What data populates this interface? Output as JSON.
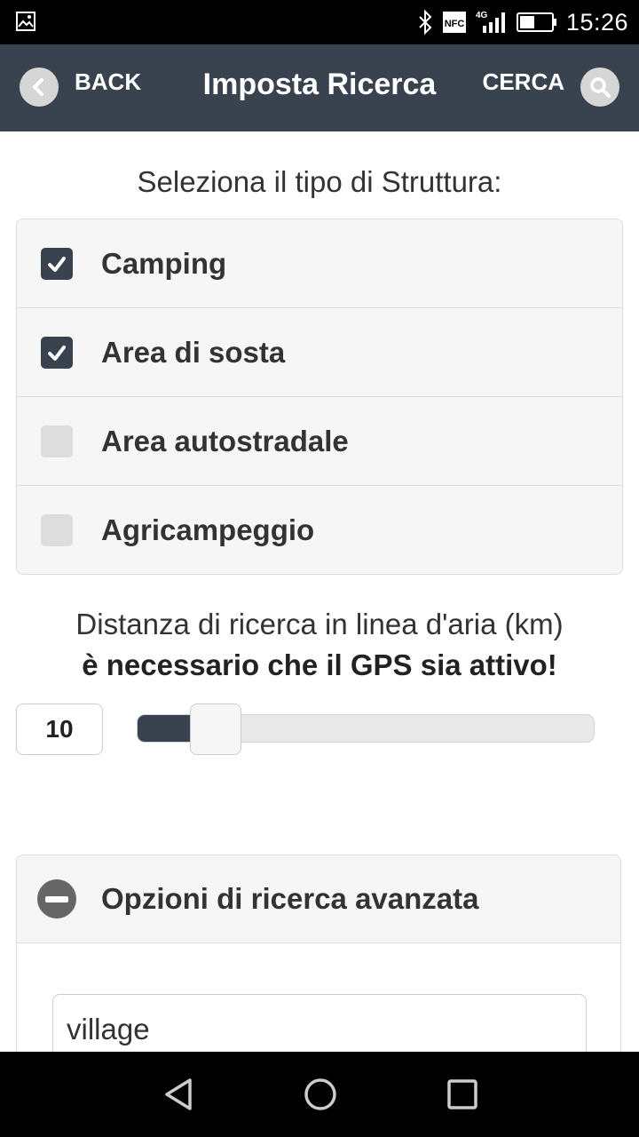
{
  "status_bar": {
    "time": "15:26",
    "icons": [
      "gallery-icon",
      "bluetooth-icon",
      "nfc-icon",
      "signal-4g-icon",
      "battery-icon"
    ],
    "nfc_label": "NFC",
    "network_label": "4G"
  },
  "header": {
    "back_label": "BACK",
    "title": "Imposta Ricerca",
    "search_label": "CERCA"
  },
  "structure": {
    "prompt": "Seleziona il tipo di Struttura:",
    "items": [
      {
        "label": "Camping",
        "checked": true
      },
      {
        "label": "Area di sosta",
        "checked": true
      },
      {
        "label": "Area autostradale",
        "checked": false
      },
      {
        "label": "Agricampeggio",
        "checked": false
      }
    ]
  },
  "distance": {
    "line1": "Distanza di ricerca in linea d'aria (km)",
    "line2": "è necessario che il GPS sia attivo!",
    "value": "10",
    "slider_fraction": 0.13
  },
  "advanced": {
    "title": "Opzioni di ricerca avanzata",
    "search_value": "village"
  },
  "colors": {
    "accent": "#38434f",
    "panel": "#f6f6f6",
    "border": "#dddddd"
  }
}
